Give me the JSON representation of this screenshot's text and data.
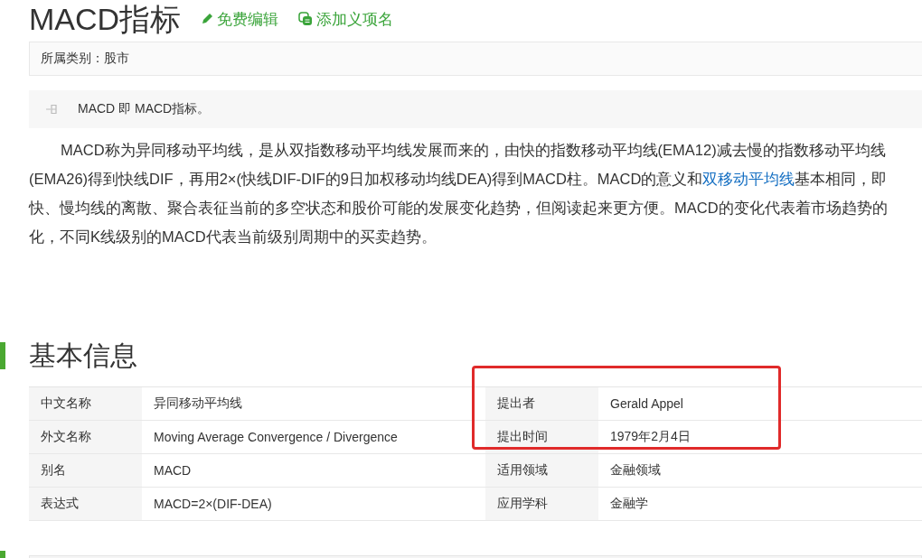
{
  "header": {
    "title": "MACD指标",
    "actions": [
      {
        "kind": "edit",
        "label": "免费编辑"
      },
      {
        "kind": "add",
        "label": "添加义项名"
      }
    ]
  },
  "category": {
    "label": "所属类别：股市"
  },
  "synonym": {
    "text": "MACD 即 MACD指标。"
  },
  "summary": {
    "lines": [
      [
        {
          "text": "MACD称为异同移动平均线，是从双指数移动平均线发展而来的，由快的指数移动平均线(EMA12)减去慢的指数移动平均线"
        }
      ],
      [
        {
          "text": "(EMA26)得到快线DIF，再用2×(快线DIF-DIF的9日加权移动均线DEA)得到MACD柱。MACD的意义和"
        },
        {
          "text": "双移动平均线",
          "kind": "link"
        },
        {
          "text": "基本相同，即"
        }
      ],
      [
        {
          "text": "快、慢均线的离散、聚合表征当前的多空状态和股价可能的发展变化趋势，但阅读起来更方便。MACD的变化代表着市场趋势的"
        }
      ],
      [
        {
          "text": "化，不同K线级别的MACD代表当前级别周期中的买卖趋势。"
        }
      ]
    ]
  },
  "basic_info": {
    "heading": "基本信息",
    "rows": [
      [
        {
          "label": "中文名称",
          "value": "异同移动平均线"
        },
        {
          "label": "提出者",
          "value": "Gerald Appel"
        }
      ],
      [
        {
          "label": "外文名称",
          "value": "Moving Average Convergence / Divergence"
        },
        {
          "label": "提出时间",
          "value": "1979年2月4日"
        }
      ],
      [
        {
          "label": "别名",
          "value": "MACD"
        },
        {
          "label": "适用领域",
          "value": "金融领域"
        }
      ],
      [
        {
          "label": "表达式",
          "value": "MACD=2×(DIF-DEA)"
        },
        {
          "label": "应用学科",
          "value": "金融学"
        }
      ]
    ]
  }
}
